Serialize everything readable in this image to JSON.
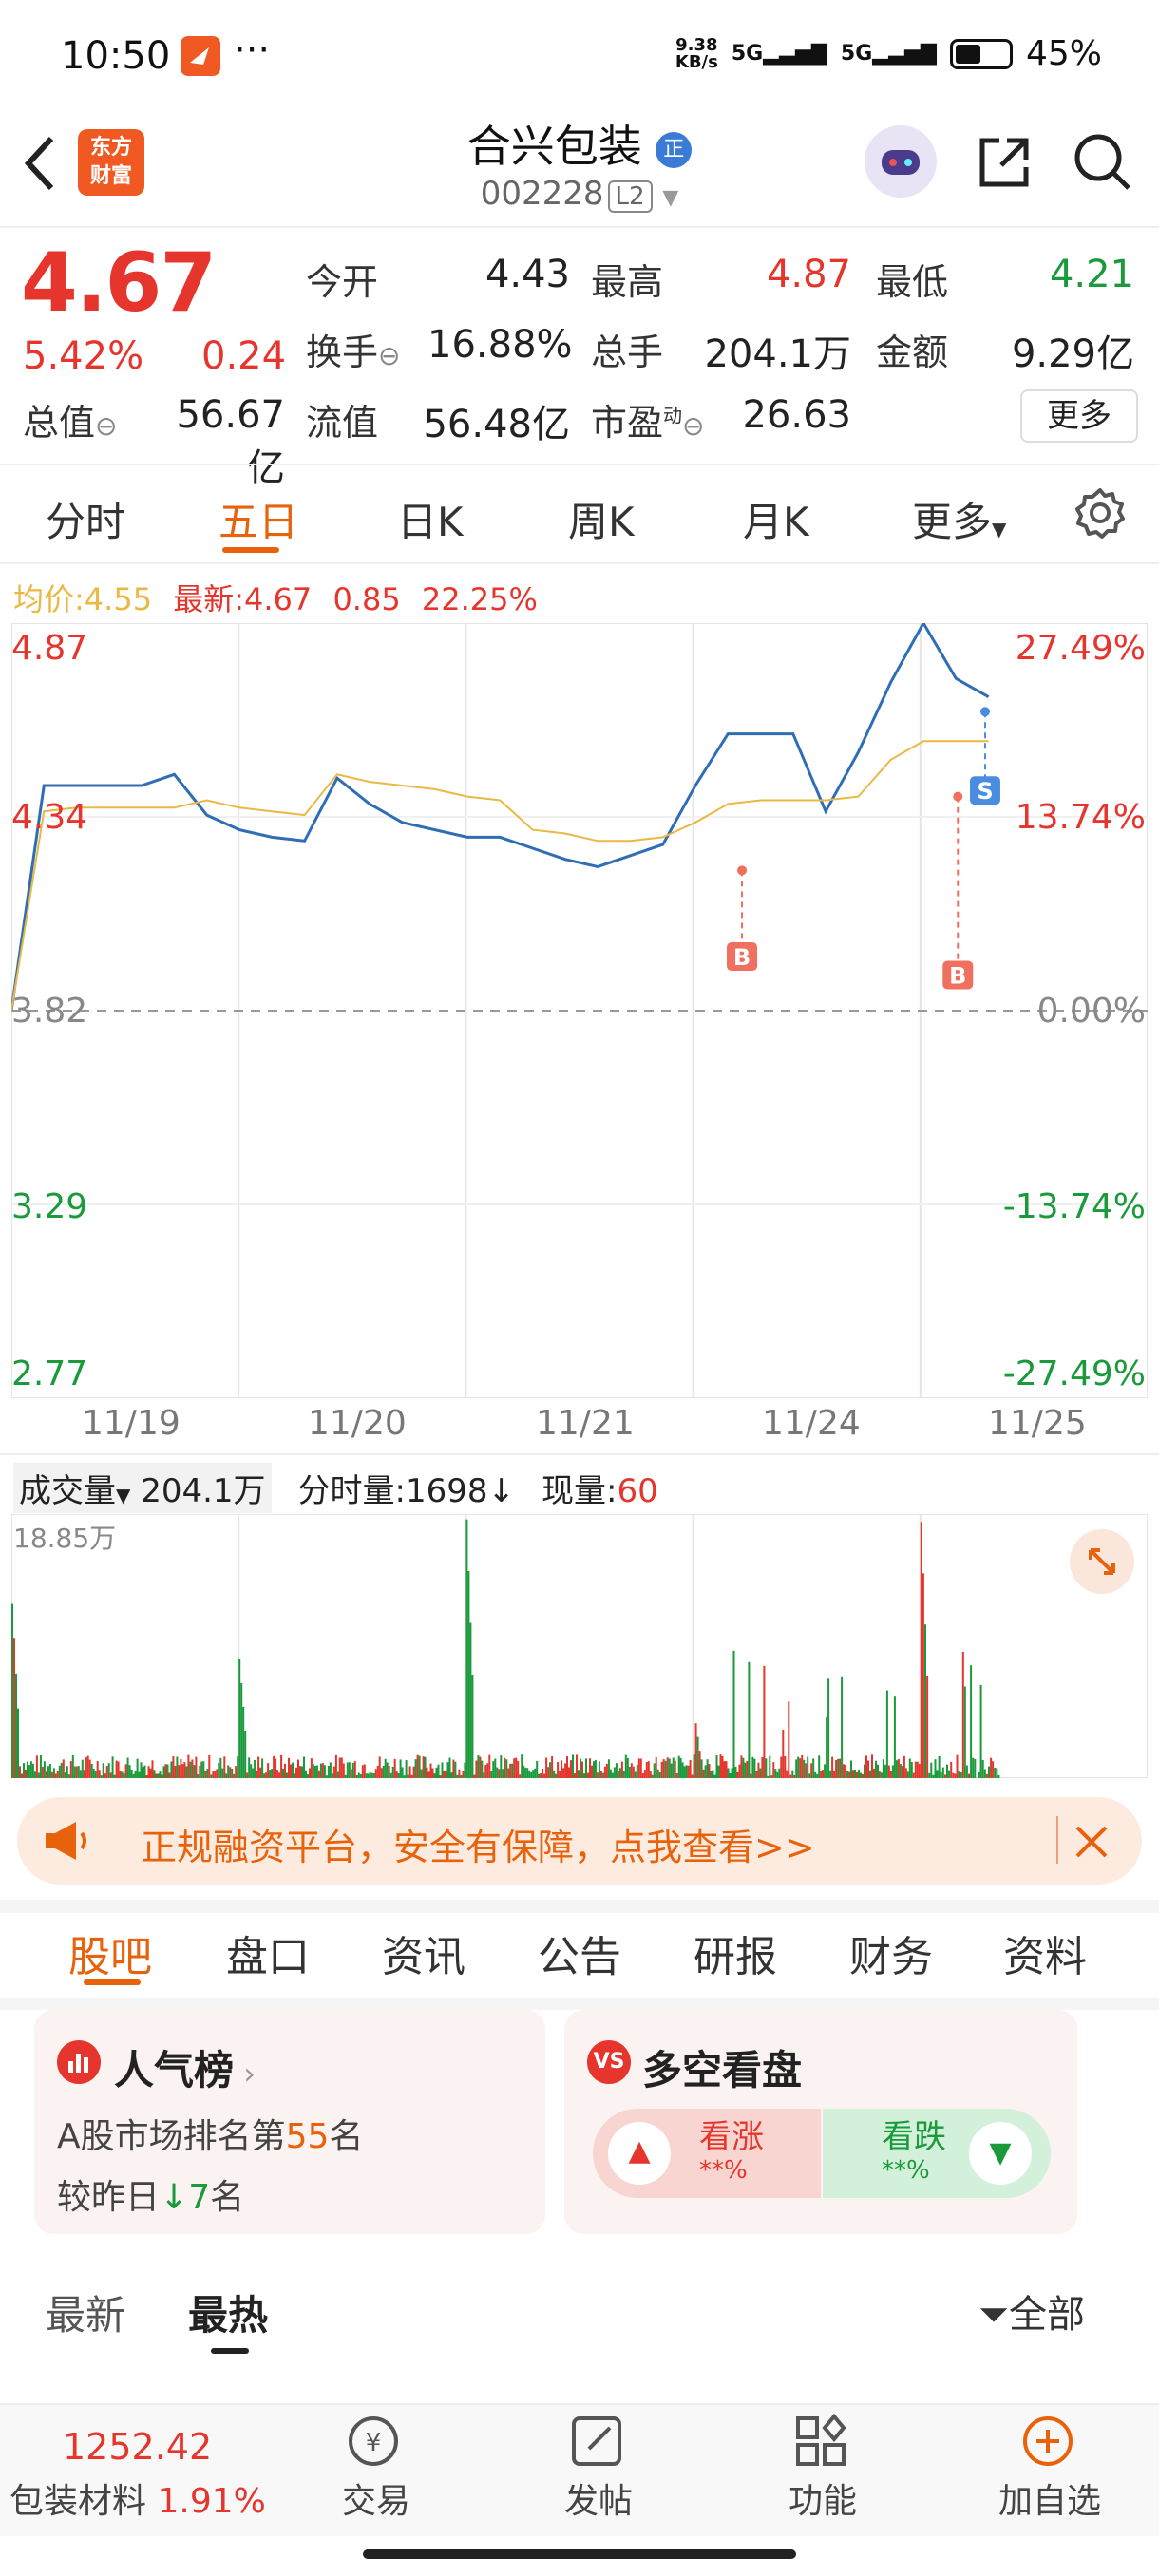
{
  "status": {
    "time": "10:50",
    "dots": "···",
    "net_speed_top": "9.38",
    "net_speed_bottom": "KB/s",
    "sig1": "5G",
    "sig2": "5G",
    "battery": "45%"
  },
  "header": {
    "logo_line1": "东方",
    "logo_line2": "财富",
    "title": "合兴包装",
    "title_badge": "正",
    "code": "002228",
    "level": "L2"
  },
  "quote": {
    "price": "4.67",
    "change_pct": "5.42%",
    "change": "0.24",
    "open_label": "今开",
    "open": "4.43",
    "high_label": "最高",
    "high": "4.87",
    "low_label": "最低",
    "low": "4.21",
    "turnover_label": "换手",
    "turnover": "16.88%",
    "volume_label": "总手",
    "volume": "204.1万",
    "amount_label": "金额",
    "amount": "9.29亿",
    "mktcap_label": "总值",
    "mktcap": "56.67亿",
    "float_label": "流值",
    "float": "56.48亿",
    "pe_label": "市盈",
    "pe_sup": "动",
    "pe": "26.63",
    "more": "更多"
  },
  "tabs": [
    "分时",
    "五日",
    "日K",
    "周K",
    "月K",
    "更多"
  ],
  "chart_legend": {
    "avg_label": "均价:",
    "avg": "4.55",
    "latest_label": "最新:",
    "latest": "4.67",
    "chg": "0.85",
    "pct": "22.25%"
  },
  "chart_data": {
    "type": "line",
    "y_left_ticks": [
      "4.87",
      "4.34",
      "3.82",
      "3.29",
      "2.77"
    ],
    "y_right_ticks": [
      "27.49%",
      "13.74%",
      "0.00%",
      "-13.74%",
      "-27.49%"
    ],
    "ylim": [
      2.77,
      4.87
    ],
    "x_labels": [
      "11/19",
      "11/20",
      "11/21",
      "11/24",
      "11/25"
    ],
    "series": [
      {
        "values": [
          3.82,
          4.43,
          4.43,
          4.43,
          4.43,
          4.46,
          4.35,
          4.31,
          4.29,
          4.28,
          4.45,
          4.38,
          4.33,
          4.31,
          4.29,
          4.29,
          4.26,
          4.23,
          4.21,
          4.24,
          4.27,
          4.43,
          4.57,
          4.57,
          4.57,
          4.36,
          4.52,
          4.71,
          4.87,
          4.72,
          4.67
        ]
      },
      {
        "values": [
          3.82,
          4.36,
          4.37,
          4.37,
          4.37,
          4.37,
          4.39,
          4.37,
          4.36,
          4.35,
          4.46,
          4.44,
          4.43,
          4.42,
          4.4,
          4.39,
          4.31,
          4.3,
          4.28,
          4.28,
          4.29,
          4.33,
          4.38,
          4.39,
          4.39,
          4.39,
          4.4,
          4.5,
          4.55,
          4.55,
          4.55
        ]
      }
    ],
    "markers": [
      "B",
      "B",
      "S"
    ]
  },
  "volume": {
    "label": "成交量",
    "total": "204.1万",
    "minute_label": "分时量:",
    "minute": "1698",
    "minute_arrow": "↓",
    "now_label": "现量:",
    "now": "60",
    "max": "18.85万"
  },
  "banner": {
    "text": "正规融资平台，安全有保障，点我查看>>"
  },
  "sub_tabs": [
    "股吧",
    "盘口",
    "资讯",
    "公告",
    "研报",
    "财务",
    "资料"
  ],
  "popularity": {
    "title": "人气榜",
    "rank_prefix": "A股市场排名第",
    "rank": "55",
    "rank_suffix": "名",
    "change_prefix": "较昨日",
    "change": "7",
    "change_suffix": "名"
  },
  "sentiment": {
    "title": "多空看盘",
    "up_label": "看涨",
    "up_value": "**%",
    "down_label": "看跌",
    "down_value": "**%"
  },
  "feed_tabs": {
    "latest": "最新",
    "hot": "最热",
    "filter": "全部"
  },
  "bottom": {
    "sector_value": "1252.42",
    "sector_name": "包装材料",
    "sector_pct": "1.91%",
    "trade": "交易",
    "post": "发帖",
    "function": "功能",
    "add": "加自选"
  },
  "colors": {
    "red": "#e5352c",
    "green": "#1a9a3a",
    "orange": "#e8620c",
    "price_line": "#2f6db5",
    "avg_line": "#eab845"
  }
}
